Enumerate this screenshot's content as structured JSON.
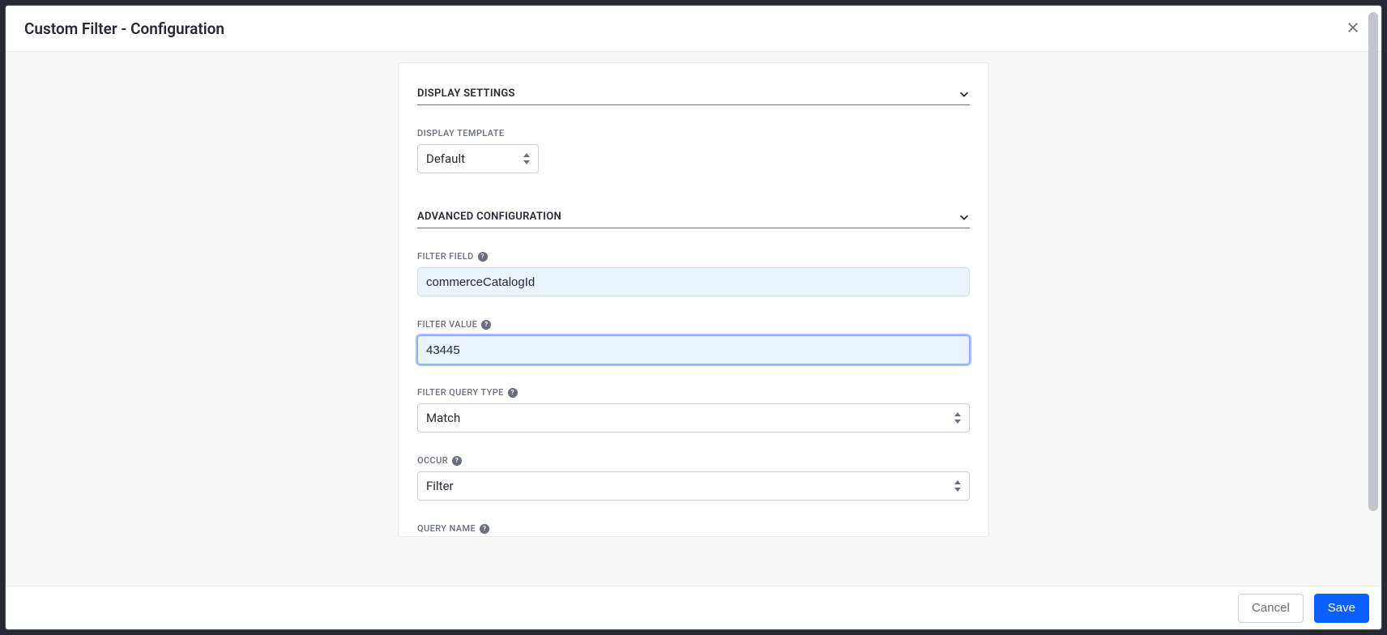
{
  "modal": {
    "title": "Custom Filter - Configuration"
  },
  "sections": {
    "display": {
      "title": "DISPLAY SETTINGS",
      "template_label": "DISPLAY TEMPLATE",
      "template_value": "Default"
    },
    "advanced": {
      "title": "ADVANCED CONFIGURATION",
      "filter_field_label": "FILTER FIELD",
      "filter_field_value": "commerceCatalogId",
      "filter_value_label": "FILTER VALUE",
      "filter_value_value": "43445",
      "filter_query_type_label": "FILTER QUERY TYPE",
      "filter_query_type_value": "Match",
      "occur_label": "OCCUR",
      "occur_value": "Filter",
      "query_name_label": "QUERY NAME"
    }
  },
  "footer": {
    "cancel": "Cancel",
    "save": "Save"
  },
  "help_icon": "?"
}
